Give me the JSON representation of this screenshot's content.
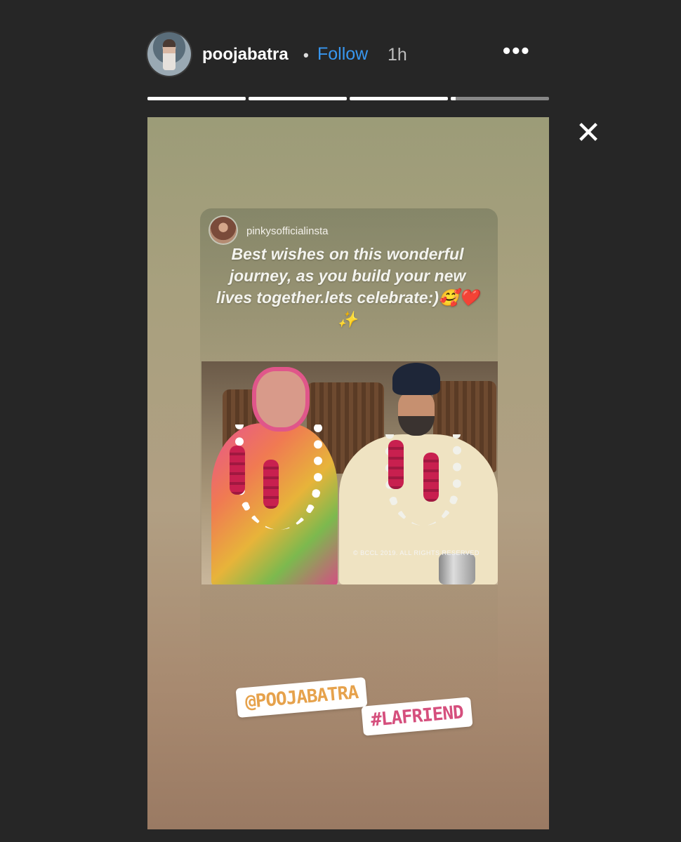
{
  "header": {
    "username": "poojabatra",
    "separator": "•",
    "follow_label": "Follow",
    "time": "1h",
    "more_label": "•••"
  },
  "progress": {
    "segments": [
      1,
      1,
      1,
      0.05
    ]
  },
  "close_label": "✕",
  "story": {
    "original_user": "pinkysofficialinsta",
    "quote": "Best wishes on this wonderful journey, as you build your new lives together.lets celebrate:)🥰❤️✨",
    "photo_watermark": "© BCCL 2019. ALL RIGHTS RESERVED",
    "mention_sticker": "@POOJABATRA",
    "hashtag_sticker": "#LAFRIEND"
  },
  "colors": {
    "background": "#262626",
    "follow": "#3897f0",
    "mention": "#e6a24c",
    "hashtag": "#d54f7d"
  }
}
